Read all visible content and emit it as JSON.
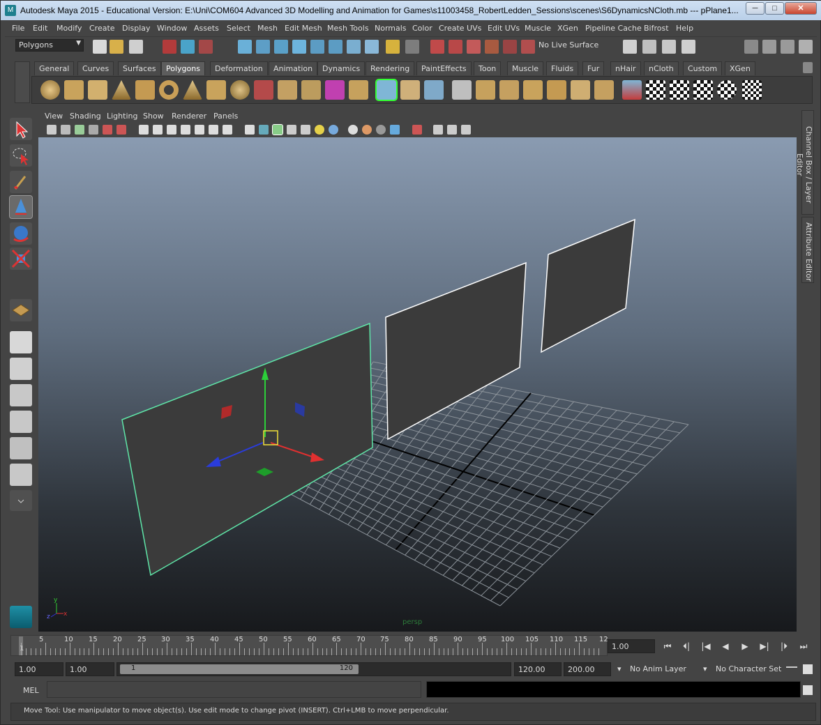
{
  "window": {
    "title": "Autodesk Maya 2015 - Educational Version: E:\\Uni\\COM604 Advanced 3D Modelling and Animation for Games\\s11003458_RobertLedden_Sessions\\scenes\\S6DynamicsNCloth.mb  ---  pPlane1...",
    "controls": {
      "minimize": "─",
      "maximize": "□",
      "close": "✕"
    }
  },
  "menubar": [
    "File",
    "Edit",
    "Modify",
    "Create",
    "Display",
    "Window",
    "Assets",
    "Select",
    "Mesh",
    "Edit Mesh",
    "Mesh Tools",
    "Normals",
    "Color",
    "Create UVs",
    "Edit UVs",
    "Muscle",
    "XGen",
    "Pipeline Cache",
    "Bifrost",
    "Help"
  ],
  "statusline": {
    "mode": "Polygons",
    "live_surface": "No Live Surface"
  },
  "shelf": {
    "tabs": [
      "General",
      "Curves",
      "Surfaces",
      "Polygons",
      "Deformation",
      "Animation",
      "Dynamics",
      "Rendering",
      "PaintEffects",
      "Toon",
      "Muscle",
      "Fluids",
      "Fur",
      "nHair",
      "nCloth",
      "Custom",
      "XGen"
    ],
    "active_tab": "Polygons"
  },
  "panel": {
    "menu": [
      "View",
      "Shading",
      "Lighting",
      "Show",
      "Renderer",
      "Panels"
    ],
    "camera": "persp",
    "axis_labels": {
      "x": "x",
      "y": "y",
      "z": "z"
    }
  },
  "side_tabs": [
    "Channel Box / Layer Editor",
    "Attribute Editor"
  ],
  "timeslider": {
    "ticks": [
      "1",
      "5",
      "10",
      "15",
      "20",
      "25",
      "30",
      "35",
      "40",
      "45",
      "50",
      "55",
      "60",
      "65",
      "70",
      "75",
      "80",
      "85",
      "90",
      "95",
      "100",
      "105",
      "110",
      "115",
      "12"
    ],
    "current_frame": "1.00"
  },
  "range": {
    "start_time": "1.00",
    "playback_start": "1.00",
    "range_start_label": "1",
    "range_end_label": "120",
    "playback_end": "120.00",
    "end_time": "200.00",
    "anim_layer": "No Anim Layer",
    "character_set": "No Character Set"
  },
  "commandline": {
    "label": "MEL"
  },
  "helpline": "Move Tool: Use manipulator to move object(s). Use edit mode to change pivot (INSERT).  Ctrl+LMB to move perpendicular.",
  "playback": [
    "⏮",
    "⏴|",
    "|◀",
    "◀",
    "▶",
    "▶|",
    "|⏵",
    "⏭"
  ]
}
